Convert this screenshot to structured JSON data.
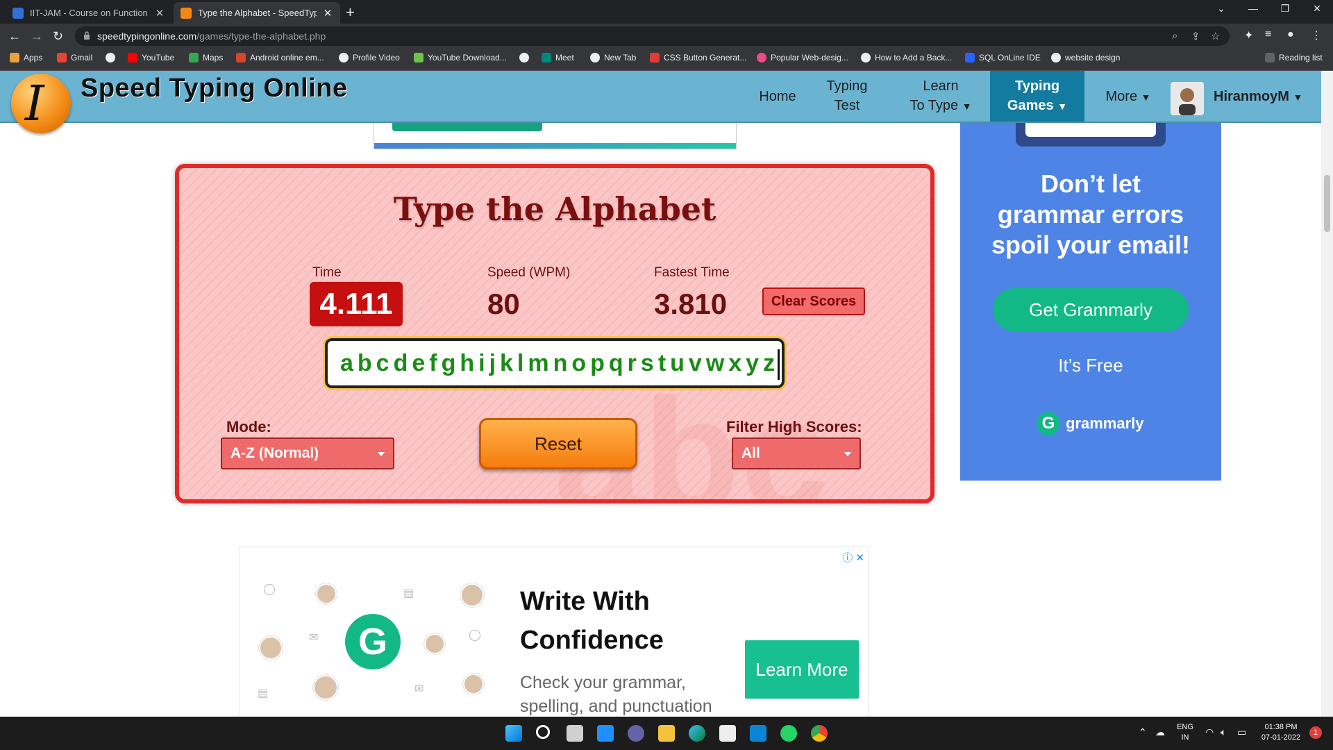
{
  "browser": {
    "tabs": [
      {
        "title": "IIT-JAM - Course on Function of",
        "active": false
      },
      {
        "title": "Type the Alphabet - SpeedTyping",
        "active": true
      }
    ],
    "url_domain": "speedtypingonline.com",
    "url_path": "/games/type-the-alphabet.php",
    "bookmarks": [
      "Apps",
      "Gmail",
      "YouTube",
      "Maps",
      "Android online em...",
      "Profile Video",
      "YouTube Download...",
      "Meet",
      "New Tab",
      "CSS Button Generat...",
      "Popular Web-desig...",
      "How to Add a Back...",
      "SQL OnLine IDE",
      "website design"
    ],
    "reading_list": "Reading list"
  },
  "site": {
    "logo_letter": "I",
    "title": "Speed Typing Online",
    "nav": {
      "home": "Home",
      "typing_test_1": "Typing",
      "typing_test_2": "Test",
      "learn_1": "Learn",
      "learn_2": "To Type",
      "games_1": "Typing",
      "games_2": "Games",
      "more": "More",
      "user": "HiranmoyM"
    }
  },
  "game": {
    "title": "Type the Alphabet",
    "time_label": "Time",
    "time_value": "4.111",
    "speed_label": "Speed (WPM)",
    "speed_value": "80",
    "fastest_label": "Fastest Time",
    "fastest_value": "3.810",
    "clear_scores": "Clear Scores",
    "typed_text": "abcdefghijklmnopqrstuvwxyz",
    "mode_label": "Mode:",
    "mode_value": "A-Z (Normal)",
    "reset": "Reset",
    "filter_label": "Filter High Scores:",
    "filter_value": "All",
    "watermark": "abc"
  },
  "side_ad": {
    "headline_1": "Don’t let",
    "headline_2": "grammar errors",
    "headline_3": "spoil your email!",
    "cta": "Get Grammarly",
    "sub": "It’s Free",
    "brand": "grammarly",
    "logo": "G"
  },
  "bottom_ad": {
    "headline_1": "Write With",
    "headline_2": "Confidence",
    "sub_1": "Check your grammar,",
    "sub_2": "spelling, and punctuation",
    "cta": "Learn More",
    "logo": "G"
  },
  "taskbar": {
    "lang_1": "ENG",
    "lang_2": "IN",
    "time": "01:38 PM",
    "date": "07-01-2022",
    "notifications": "1"
  },
  "colors": {
    "nav_bg": "#6ab4d2",
    "game_border": "#e02a2a",
    "grammarly_green": "#12b886",
    "side_ad_bg": "#4e84e6"
  }
}
